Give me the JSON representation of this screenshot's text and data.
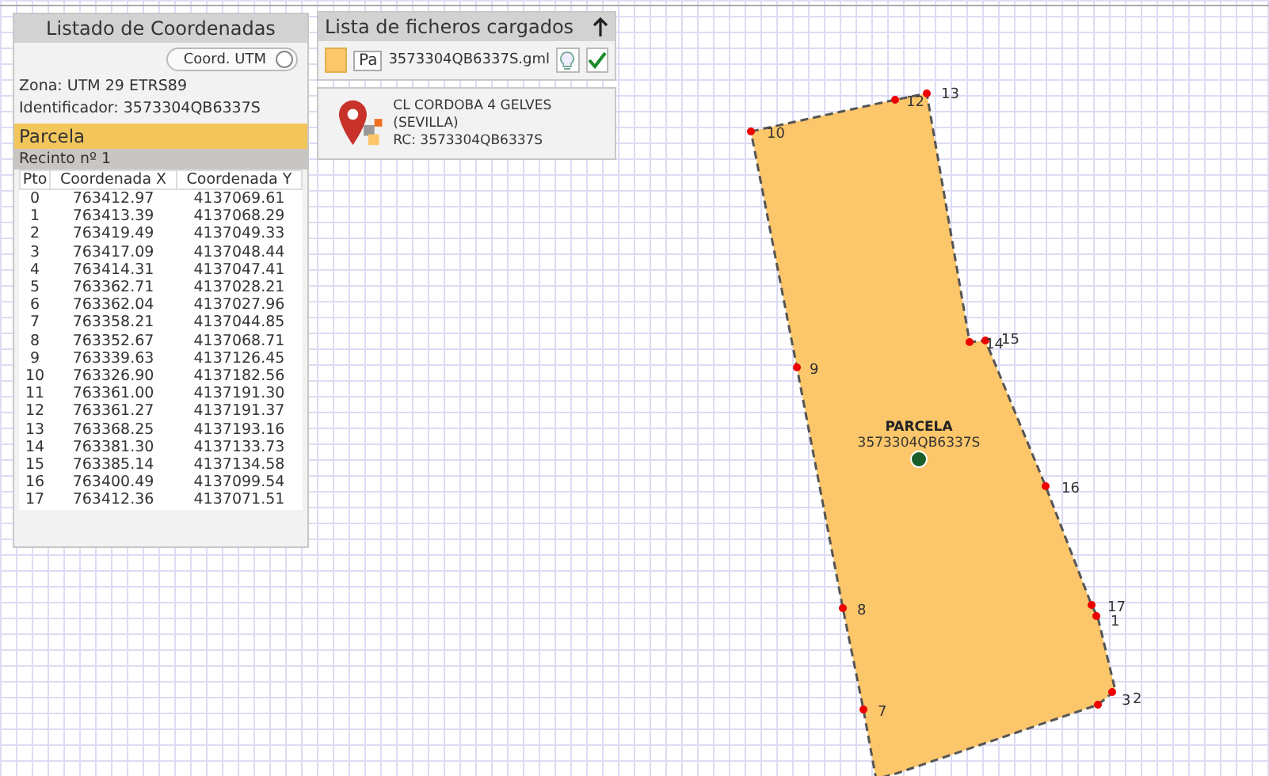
{
  "coord_panel": {
    "title": "Listado de Coordenadas",
    "utm_toggle": {
      "label": "Coord. UTM",
      "on": false
    },
    "zone": "Zona: UTM 29 ETRS89",
    "identifier": "Identificador: 3573304QB6337S",
    "section": "Parcela",
    "enclosure": "Recinto nº 1",
    "columns": [
      "Pto",
      "Coordenada X",
      "Coordenada Y"
    ],
    "rows": [
      [
        "0",
        "763412.97",
        "4137069.61"
      ],
      [
        "1",
        "763413.39",
        "4137068.29"
      ],
      [
        "2",
        "763419.49",
        "4137049.33"
      ],
      [
        "3",
        "763417.09",
        "4137048.44"
      ],
      [
        "4",
        "763414.31",
        "4137047.41"
      ],
      [
        "5",
        "763362.71",
        "4137028.21"
      ],
      [
        "6",
        "763362.04",
        "4137027.96"
      ],
      [
        "7",
        "763358.21",
        "4137044.85"
      ],
      [
        "8",
        "763352.67",
        "4137068.71"
      ],
      [
        "9",
        "763339.63",
        "4137126.45"
      ],
      [
        "10",
        "763326.90",
        "4137182.56"
      ],
      [
        "11",
        "763361.00",
        "4137191.30"
      ],
      [
        "12",
        "763361.27",
        "4137191.37"
      ],
      [
        "13",
        "763368.25",
        "4137193.16"
      ],
      [
        "14",
        "763381.30",
        "4137133.73"
      ],
      [
        "15",
        "763385.14",
        "4137134.58"
      ],
      [
        "16",
        "763400.49",
        "4137099.54"
      ],
      [
        "17",
        "763412.36",
        "4137071.51"
      ]
    ]
  },
  "files_panel": {
    "title": "Lista de ficheros cargados",
    "files": [
      {
        "color": "#fcc66a",
        "tag": "Pa",
        "name": "3573304QB6337S.gml"
      }
    ],
    "info": {
      "address": "CL CORDOBA 4 GELVES (SEVILLA)",
      "reference": "RC: 3573304QB6337S"
    }
  },
  "map": {
    "parcel": {
      "label": "PARCELA",
      "id": "3573304QB6337S"
    },
    "vertex_labels": [
      "10",
      "12",
      "13",
      "14",
      "15",
      "9",
      "16",
      "17",
      "1",
      "8",
      "7",
      "3",
      "2"
    ]
  }
}
